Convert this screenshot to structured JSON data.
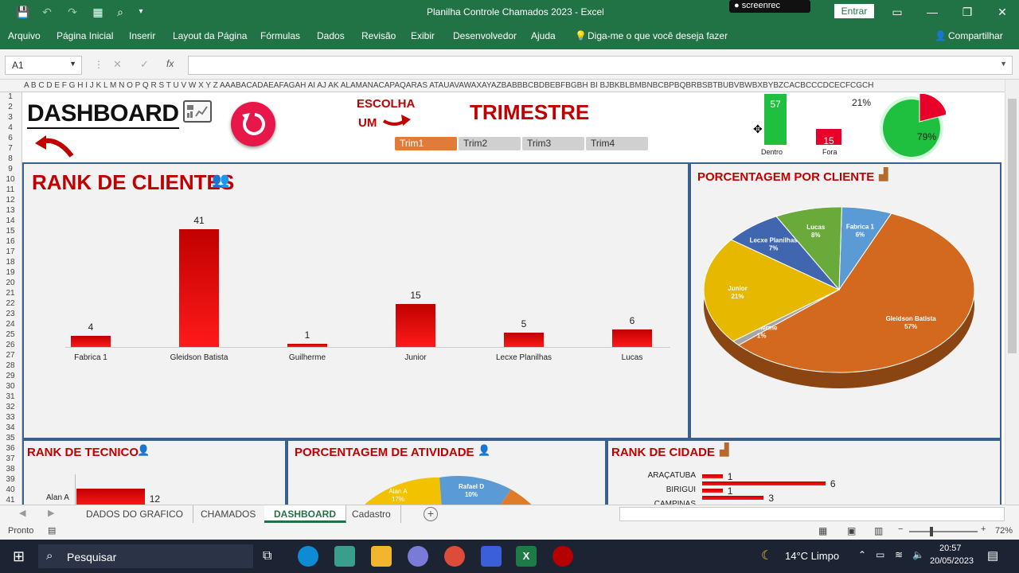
{
  "window": {
    "title": "Planilha Controle Chamados 2023  -  Excel",
    "recorder": "screenrec",
    "enter_label": "Entrar"
  },
  "menu": [
    "Arquivo",
    "Página Inicial",
    "Inserir",
    "Layout da Página",
    "Fórmulas",
    "Dados",
    "Revisão",
    "Exibir",
    "Desenvolvedor",
    "Ajuda"
  ],
  "tellme": "Diga-me o que você deseja fazer",
  "share": "Compartilhar",
  "namebox": "A1",
  "fx": "fx",
  "columns": "A   B   C D E F G H  I  J  K  L  M N  O  P  Q  R  S  T  U  V  W  X  Y  Z  AAABACADAEAFAGAH AI AJ AK ALAMANACAPAQARAS ATAUAVAWAXAYAZBABBBCBDBEBFBGBH BI BJBKBLBMBNBCBPBQBRBSBTBUBVBWBXBYBZCACBCCCDCECFCGCH",
  "rows": [
    "1",
    "2",
    "3",
    "4",
    "6",
    "7",
    "8",
    "9",
    "10",
    "11",
    "12",
    "13",
    "14",
    "15",
    "16",
    "17",
    "18",
    "19",
    "20",
    "21",
    "22",
    "23",
    "24",
    "25",
    "26",
    "27",
    "28",
    "29",
    "30",
    "31",
    "32",
    "33",
    "34",
    "35",
    "36",
    "37",
    "38",
    "39",
    "40",
    "41"
  ],
  "dashboard": {
    "title": "DASHBOARD",
    "choose_line1": "ESCOLHA",
    "choose_line2": "UM",
    "period_label": "TRIMESTRE",
    "trims": [
      "Trim1",
      "Trim2",
      "Trim3",
      "Trim4"
    ],
    "selected_trim": "Trim1",
    "status": {
      "dentro_value": "57",
      "dentro_label": "Dentro",
      "fora_value": "15",
      "fora_label": "Fora"
    },
    "donut": {
      "outside_pct": "21%",
      "inside_pct": "79%",
      "outside": 0.21
    }
  },
  "rank_clientes": {
    "title": "RANK DE CLIENTES",
    "chart_data": {
      "type": "bar",
      "categories": [
        "Fabrica 1",
        "Gleidson Batista",
        "Guilherme",
        "Junior",
        "Lecxe Planilhas",
        "Lucas"
      ],
      "values": [
        4,
        41,
        1,
        15,
        5,
        6
      ],
      "title": "RANK DE CLIENTES"
    }
  },
  "porcentagem_cliente": {
    "title": "PORCENTAGEM POR CLIENTE",
    "chart_data": {
      "type": "pie",
      "categories": [
        "Fabrica 1",
        "Gleidson Batista",
        "Guilherme",
        "Junior",
        "Lecxe Planilhas",
        "Lucas"
      ],
      "values": [
        6,
        57,
        1,
        21,
        7,
        8
      ],
      "labels": [
        "6%",
        "57%",
        "1%",
        "21%",
        "7%",
        "8%"
      ],
      "colors": [
        "#5b9bd5",
        "#d2691e",
        "#a5a5a5",
        "#e6b800",
        "#4166b0",
        "#6aaa3a"
      ]
    }
  },
  "rank_tecnico": {
    "title": "RANK DE TECNICO",
    "chart_data": {
      "type": "bar",
      "categories": [
        "Alan A"
      ],
      "values": [
        12
      ]
    }
  },
  "porcentagem_atividade": {
    "title": "PORCENTAGEM DE ATIVIDADE",
    "chart_data": {
      "type": "pie",
      "categories": [
        "Alan A",
        "Rafael D"
      ],
      "labels": [
        "17%",
        "10%"
      ],
      "values": [
        17,
        10
      ]
    }
  },
  "rank_cidade": {
    "title": "RANK DE CIDADE",
    "chart_data": {
      "type": "bar",
      "categories": [
        "ARAÇATUBA",
        "BIRIGUI",
        "CAMPINAS"
      ],
      "values": [
        1,
        6,
        1,
        3
      ]
    },
    "labels": [
      "1",
      "6",
      "1",
      "3"
    ]
  },
  "sheets": [
    "DADOS DO GRAFICO",
    "CHAMADOS",
    "DASHBOARD",
    "Cadastro"
  ],
  "active_sheet": "DASHBOARD",
  "status_text": "Pronto",
  "zoom": "72%",
  "taskbar": {
    "search": "Pesquisar",
    "weather": "14°C  Limpo",
    "time": "20:57",
    "date": "20/05/2023"
  }
}
